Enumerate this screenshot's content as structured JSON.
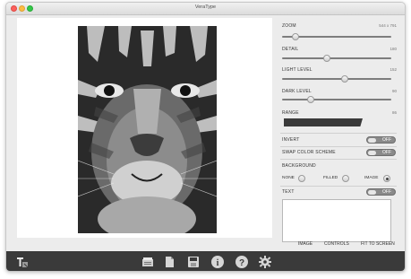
{
  "window": {
    "title": "VeraType"
  },
  "controls": {
    "zoom": {
      "label": "ZOOM",
      "value": "544 x 791",
      "level": 0.12
    },
    "detail": {
      "label": "DETAIL",
      "value": "180",
      "level": 0.41
    },
    "light": {
      "label": "LIGHT LEVEL",
      "value": "152",
      "level": 0.57
    },
    "dark": {
      "label": "DARK LEVEL",
      "value": "90",
      "level": 0.26
    },
    "range": {
      "label": "RANGE",
      "value": "86"
    }
  },
  "toggles": {
    "invert": {
      "label": "INVERT",
      "state": "OFF"
    },
    "swap": {
      "label": "SWAP COLOR SCHEME",
      "state": "OFF"
    },
    "text": {
      "label": "TEXT",
      "state": "OFF"
    }
  },
  "background": {
    "label": "BACKGROUND",
    "options": [
      "NONE",
      "FILLED",
      "IMAGE"
    ],
    "selected": "IMAGE"
  },
  "bottom_links": {
    "image": "IMAGE",
    "controls": "CONTROLS",
    "fit": "FIT TO SCREEN"
  },
  "toolbar": {
    "icons": [
      "app-logo-icon",
      "open-icon",
      "copy-icon",
      "save-icon",
      "info-icon",
      "help-icon",
      "settings-gear-icon"
    ],
    "help_glyph": "?",
    "info_glyph": "i"
  },
  "colors": {
    "toolbar_bg": "#3a3a3a",
    "toggle_bg": "#8a8a8a",
    "window_bg": "#ececec"
  }
}
